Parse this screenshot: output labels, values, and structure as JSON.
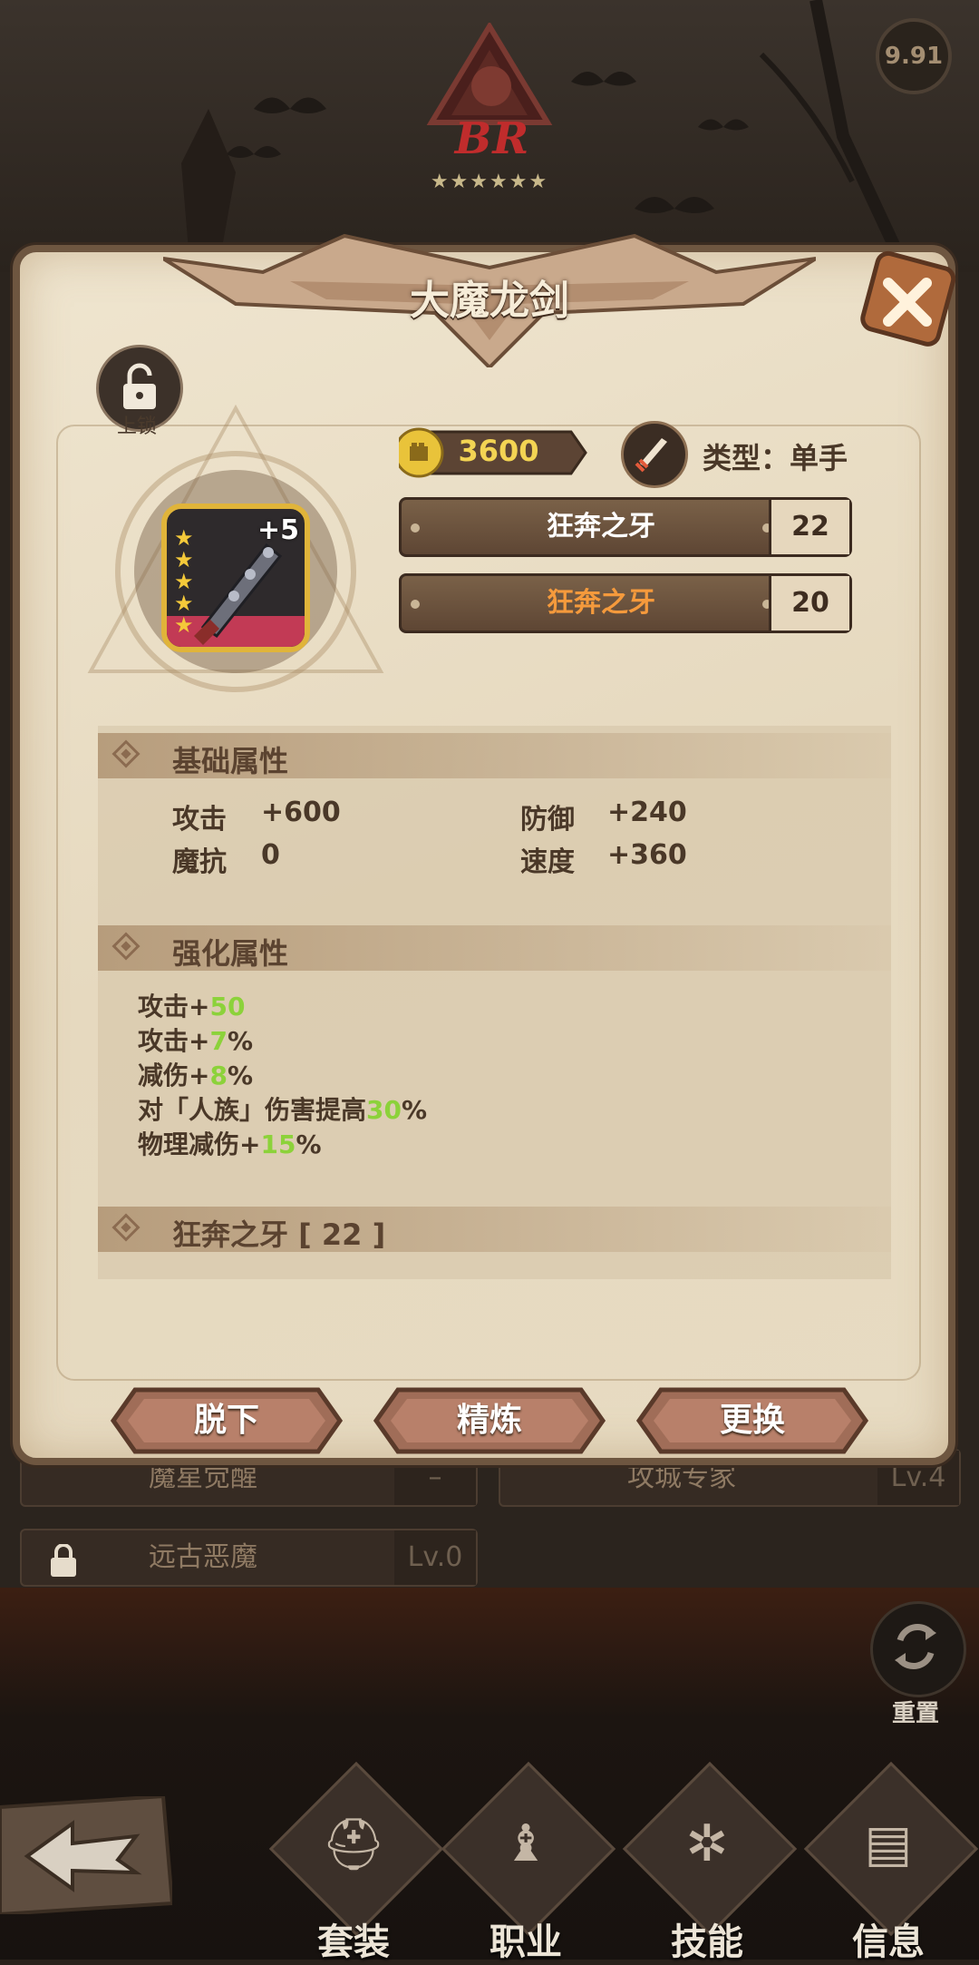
{
  "header": {
    "rank_badge": "BR",
    "rank_stars": "★★★★★★",
    "version": "9.91"
  },
  "item": {
    "name": "大魔龙剑",
    "lock_label": "上锁",
    "enhance_level": "+5",
    "star_count": 5,
    "power": "3600",
    "type_label": "类型：单手",
    "set_bonuses": [
      {
        "name": "狂奔之牙",
        "count": "22",
        "color": "#ffffff"
      },
      {
        "name": "狂奔之牙",
        "count": "20",
        "color": "#f59a3c"
      }
    ]
  },
  "base_stats": {
    "title": "基础属性",
    "attack_label": "攻击",
    "attack_value": "+600",
    "defense_label": "防御",
    "defense_value": "+240",
    "magic_res_label": "魔抗",
    "magic_res_value": "0",
    "speed_label": "速度",
    "speed_value": "+360"
  },
  "enhance_stats": {
    "title": "强化属性",
    "lines": [
      {
        "prefix": "攻击+",
        "value": "50",
        "suffix": ""
      },
      {
        "prefix": "攻击+",
        "value": "7",
        "suffix": "%"
      },
      {
        "prefix": "减伤+",
        "value": "8",
        "suffix": "%"
      },
      {
        "prefix": "对「人族」伤害提高",
        "value": "30",
        "suffix": "%"
      },
      {
        "prefix": "物理减伤+",
        "value": "15",
        "suffix": "%"
      }
    ]
  },
  "set_section": {
    "title": "狂奔之牙 [ 22 ]"
  },
  "actions": {
    "unequip": "脱下",
    "refine": "精炼",
    "replace": "更换"
  },
  "background_rows": {
    "row1_name": "魔星觉醒",
    "row1_level": "–",
    "row2_name": "攻城专家",
    "row2_level": "Lv.4",
    "row3_name": "远古恶魔",
    "row3_level": "Lv.0"
  },
  "reset_label": "重置",
  "nav": [
    {
      "label": "套装",
      "icon": "helmet-icon"
    },
    {
      "label": "职业",
      "icon": "chess-piece-icon"
    },
    {
      "label": "技能",
      "icon": "skill-rune-icon"
    },
    {
      "label": "信息",
      "icon": "document-icon"
    }
  ],
  "colors": {
    "accent_green": "#8cd23a",
    "gold": "#f3d453",
    "panel": "#e6d9bf",
    "rank_red": "#c02c2c"
  }
}
